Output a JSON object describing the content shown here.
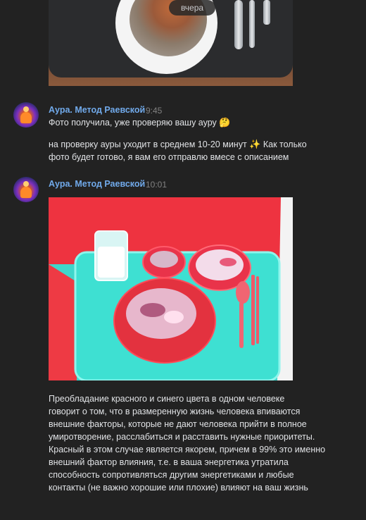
{
  "date_divider": "вчера",
  "messages": [
    {
      "author": "Аура. Метод Раевской",
      "time": "9:45",
      "lines": [
        "Фото получила, уже проверяю вашу ауру",
        "на проверку ауры уходит в среднем 10-20 минут",
        "Как только",
        "фото будет готово, я вам его отправлю вмесе с описанием"
      ],
      "emoji": [
        "🤔",
        "✨"
      ]
    },
    {
      "author": "Аура. Метод Раевской",
      "time": "10:01",
      "paragraph_lines": [
        "Преобладание красного и синего цвета в одном человеке",
        "говорит о том, что в размеренную жизнь человека впиваются",
        "внешние факторы, которые не дают человека прийти в полное",
        "умиротворение, расслабиться и расставить нужные приоритеты.",
        "Красный в этом случае является якорем, причем в 99% это именно",
        "внешний фактор влияния, т.е. в ваша энергетика утратила",
        "способность сопротивляться другим энергетиками и любые",
        "контакты (не важно хорошие или плохие) влияют на ваш жизнь"
      ]
    }
  ],
  "colors": {
    "background": "#222222",
    "author": "#71aaeb",
    "time": "#828282",
    "text": "#e1e3e6"
  }
}
